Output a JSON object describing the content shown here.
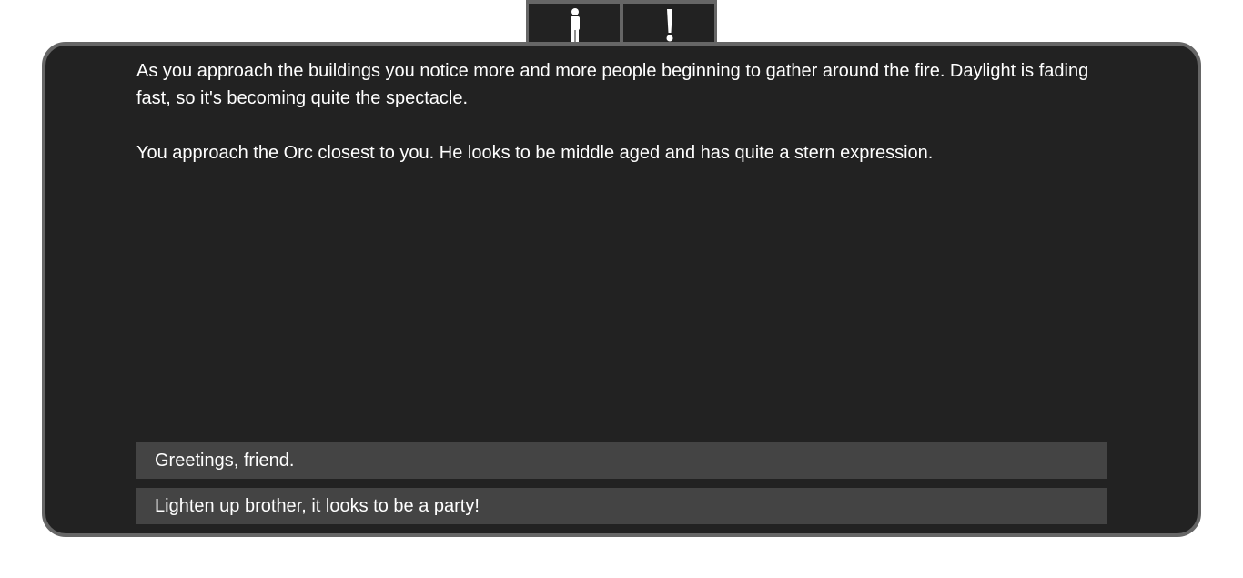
{
  "tabs": [
    {
      "icon": "person-icon"
    },
    {
      "icon": "exclamation-icon"
    }
  ],
  "story": {
    "paragraphs": [
      "As you approach the buildings you notice more and more people beginning to gather around the fire. Daylight is fading fast, so it's becoming quite the spectacle.",
      "You approach the Orc closest to you. He looks to be middle aged and has quite a stern expression."
    ]
  },
  "choices": [
    {
      "label": "Greetings, friend."
    },
    {
      "label": "Lighten up brother, it looks to be a party!"
    }
  ],
  "colors": {
    "panel_background": "#222222",
    "panel_border": "#666666",
    "choice_background": "#444444",
    "text": "#ffffff"
  }
}
